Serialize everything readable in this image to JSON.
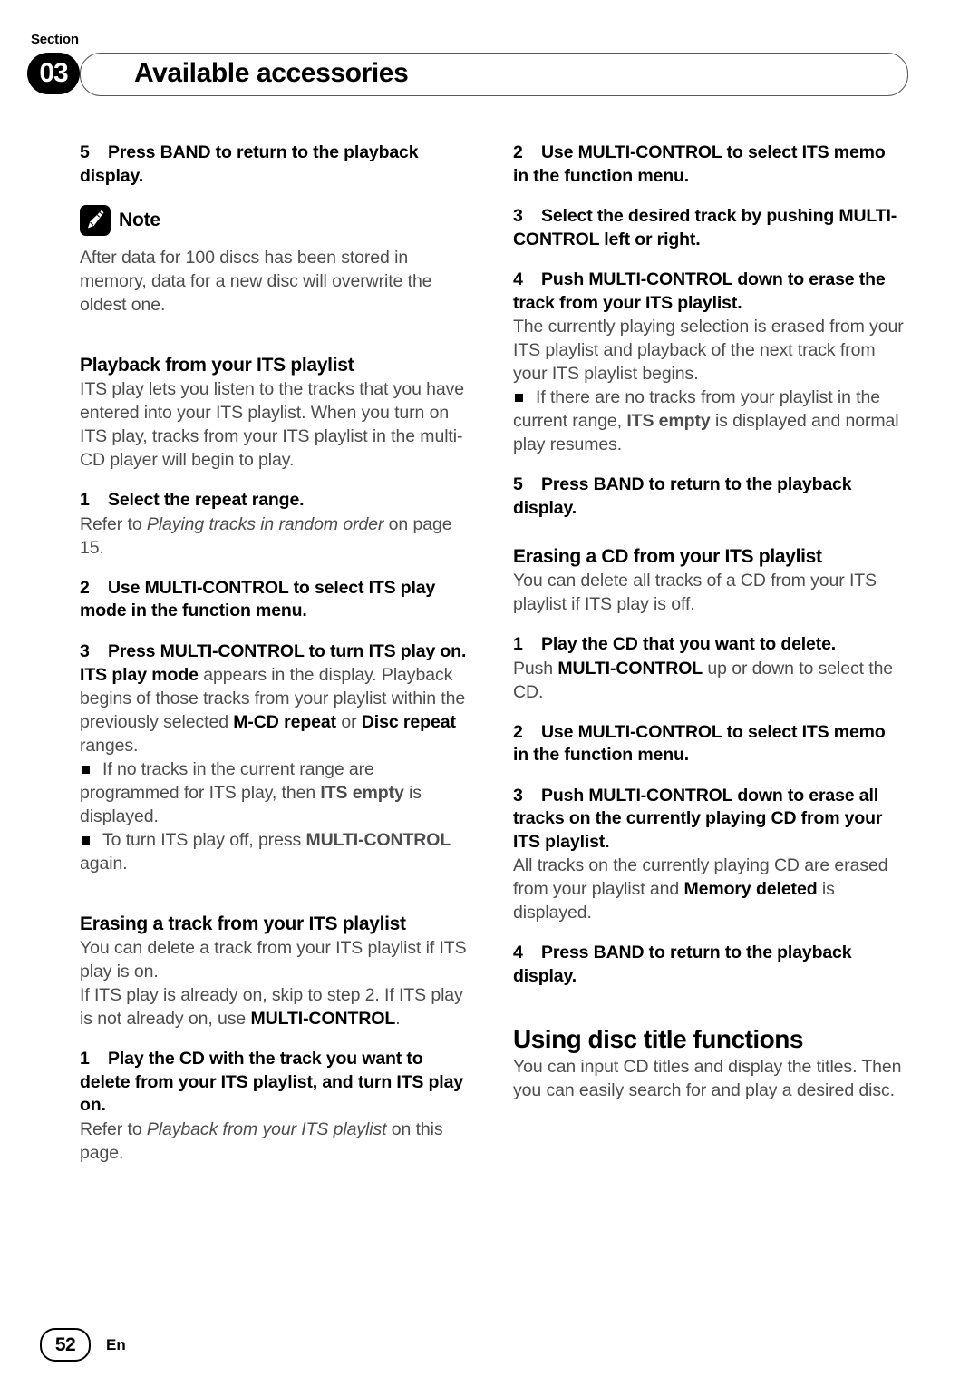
{
  "header": {
    "section_label": "Section",
    "section_number": "03",
    "title": "Available accessories"
  },
  "left_column": {
    "step_5_num": "5",
    "step_5_text": "Press BAND to return to the playback display.",
    "note_label": "Note",
    "note_icon": "pencil-icon",
    "note_body": "After data for 100 discs has been stored in memory, data for a new disc will overwrite the oldest one.",
    "heading_playback": "Playback from your ITS playlist",
    "playback_body": "ITS play lets you listen to the tracks that you have entered into your ITS playlist. When you turn on ITS play, tracks from your ITS playlist in the multi-CD player will begin to play.",
    "step_1_num": "1",
    "step_1_text": "Select the repeat range.",
    "step_1_body_pre": "Refer to ",
    "step_1_body_italic": "Playing tracks in random order",
    "step_1_body_post": " on page 15.",
    "step_2_num": "2",
    "step_2_text": "Use MULTI-CONTROL to select ITS play mode in the function menu.",
    "step_3_num": "3",
    "step_3_text": "Press MULTI-CONTROL to turn ITS play on.",
    "step_3_body_b1": "ITS play mode",
    "step_3_body_t1": " appears in the display. Playback begins of those tracks from your playlist within the previously selected ",
    "step_3_body_b2": "M-CD repeat",
    "step_3_body_t2": " or ",
    "step_3_body_b3": "Disc repeat",
    "step_3_body_t3": " ranges.",
    "bullet_1_t1": "If no tracks in the current range are programmed for ITS play, then ",
    "bullet_1_b1": "ITS empty",
    "bullet_1_t2": " is displayed.",
    "bullet_2_t1": "To turn ITS play off, press ",
    "bullet_2_b1": "MULTI-CONTROL",
    "bullet_2_t2": " again.",
    "heading_erasing_track": "Erasing a track from your ITS playlist",
    "erasing_body_1": "You can delete a track from your ITS playlist if ITS play is on.",
    "erasing_body_2_t1": "If ITS play is already on, skip to step 2. If ITS play is not already on, use ",
    "erasing_body_2_b1": "MULTI-CONTROL",
    "erasing_body_2_t2": ".",
    "erase_step_1_num": "1",
    "erase_step_1_text": "Play the CD with the track you want to delete from your ITS playlist, and turn ITS play on.",
    "erase_step_1_body_pre": "Refer to ",
    "erase_step_1_body_italic": "Playback from your ITS playlist",
    "erase_step_1_body_post": " on this page."
  },
  "right_column": {
    "step_2_num": "2",
    "step_2_text": "Use MULTI-CONTROL to select ITS memo in the function menu.",
    "step_3_num": "3",
    "step_3_text": "Select the desired track by pushing MULTI-CONTROL left or right.",
    "step_4_num": "4",
    "step_4_text": "Push MULTI-CONTROL down to erase the track from your ITS playlist.",
    "step_4_body": "The currently playing selection is erased from your ITS playlist and playback of the next track from your ITS playlist begins.",
    "bullet_1_t1": "If there are no tracks from your playlist in the current range, ",
    "bullet_1_b1": "ITS empty",
    "bullet_1_t2": " is displayed and normal play resumes.",
    "step_5_num": "5",
    "step_5_text": "Press BAND to return to the playback display.",
    "heading_erasing_cd": "Erasing a CD from your ITS playlist",
    "erasing_cd_body": "You can delete all tracks of a CD from your ITS playlist if ITS play is off.",
    "cd_step_1_num": "1",
    "cd_step_1_text": "Play the CD that you want to delete.",
    "cd_step_1_body_t1": "Push ",
    "cd_step_1_body_b1": "MULTI-CONTROL",
    "cd_step_1_body_t2": " up or down to select the CD.",
    "cd_step_2_num": "2",
    "cd_step_2_text": "Use MULTI-CONTROL to select ITS memo in the function menu.",
    "cd_step_3_num": "3",
    "cd_step_3_text": "Push MULTI-CONTROL down to erase all tracks on the currently playing CD from your ITS playlist.",
    "cd_step_3_body_t1": "All tracks on the currently playing CD are erased from your playlist and ",
    "cd_step_3_body_b1": "Memory deleted",
    "cd_step_3_body_t2": " is displayed.",
    "cd_step_4_num": "4",
    "cd_step_4_text": "Press BAND to return to the playback display.",
    "heading_disc_title": "Using disc title functions",
    "disc_title_body": "You can input CD titles and display the titles. Then you can easily search for and play a desired disc."
  },
  "footer": {
    "page_number": "52",
    "language": "En"
  }
}
